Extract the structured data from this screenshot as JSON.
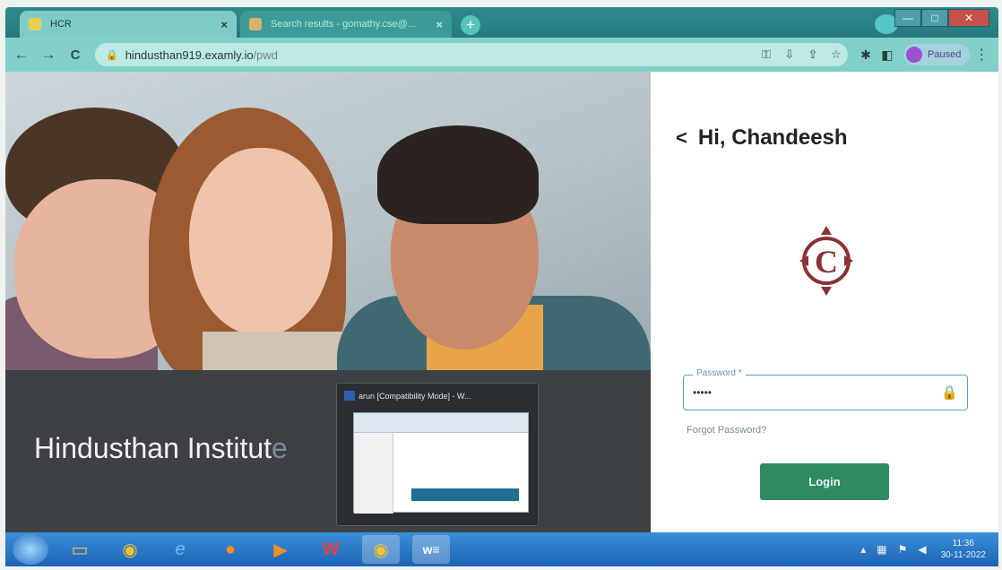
{
  "browser": {
    "tabs": [
      {
        "label": "HCR",
        "close": "×"
      },
      {
        "label": "Search results - gomathy.cse@...",
        "close": "×"
      }
    ],
    "new_tab": "+",
    "window_controls": {
      "minimize": "—",
      "maximize": "□",
      "close": "✕"
    }
  },
  "toolbar": {
    "back": "←",
    "forward": "→",
    "reload": "C",
    "url_host": "hindusthan919.examly.io",
    "url_path": "/pwd",
    "profile_status": "Paused",
    "menu": "⋮"
  },
  "hero": {
    "title_visible": "Hindusthan Institut",
    "title_faded": "e"
  },
  "preview": {
    "title": "arun [Compatibility Mode] - W..."
  },
  "login": {
    "back_arrow": "<",
    "greeting": "Hi, Chandeesh",
    "password_label": "Password *",
    "password_value": "•••••",
    "forgot_password": "Forgot Password?",
    "login_button": "Login",
    "logo_letter": "C"
  },
  "taskbar": {
    "time": "11:36",
    "date": "30-11-2022"
  },
  "colors": {
    "login_button": "#2f8a64",
    "logo": "#8a3236",
    "tab_bar": "#2f8a8a"
  }
}
